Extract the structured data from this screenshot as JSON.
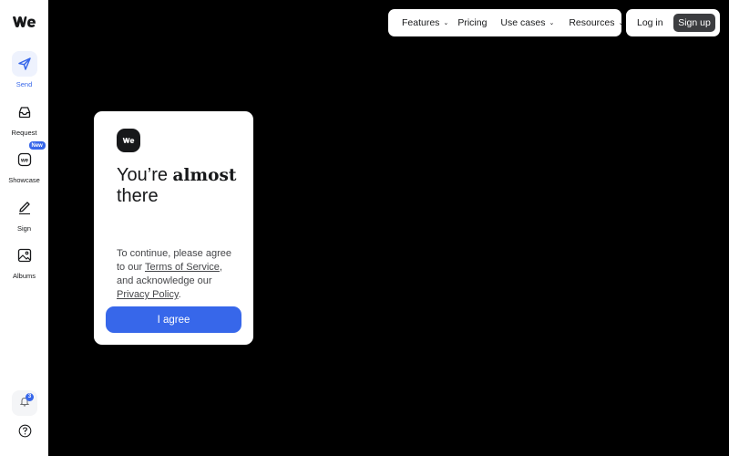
{
  "sidebar": {
    "items": [
      {
        "label": "Send",
        "icon": "paper-plane-icon"
      },
      {
        "label": "Request",
        "icon": "inbox-icon"
      },
      {
        "label": "Showcase",
        "icon": "we-square-icon",
        "badge": "New"
      },
      {
        "label": "Sign",
        "icon": "pen-icon"
      },
      {
        "label": "Albums",
        "icon": "image-icon"
      }
    ],
    "notifications_count": "3"
  },
  "topnav": {
    "features": "Features",
    "pricing": "Pricing",
    "use_cases": "Use cases",
    "resources": "Resources"
  },
  "auth": {
    "login": "Log in",
    "signup": "Sign up"
  },
  "modal": {
    "headline_prefix": "You’re",
    "headline_bold": "almost",
    "headline_suffix": "there",
    "text_1": "To continue, please agree to our",
    "terms_link": "Terms of Service",
    "text_2": ", and acknowledge our",
    "privacy_link": "Privacy Policy",
    "text_3": ".",
    "agree_button": "I agree"
  },
  "colors": {
    "accent": "#3767ea",
    "background": "#000000",
    "dark_button": "#3c3d40"
  }
}
